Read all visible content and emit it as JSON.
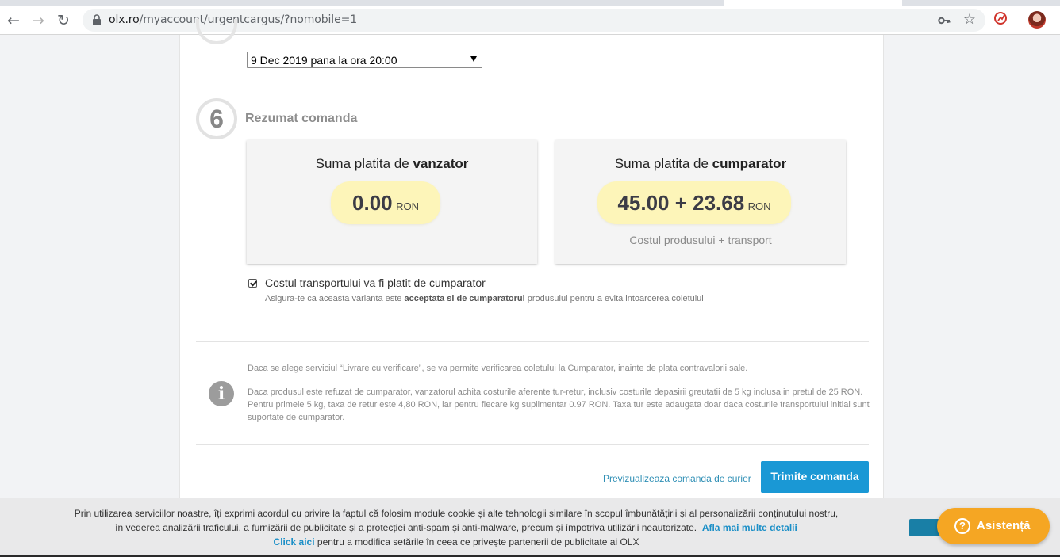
{
  "browser": {
    "url_host": "olx.ro",
    "url_path": "/myaccount/urgentcargus/?nomobile=1"
  },
  "delivery": {
    "selected_date": "9 Dec 2019 pana la ora 20:00"
  },
  "summary": {
    "step_number": "6",
    "title": "Rezumat comanda",
    "seller_title_prefix": "Suma platita de ",
    "seller_title_bold": "vanzator",
    "seller_amount": "0.00",
    "seller_currency": "RON",
    "buyer_title_prefix": "Suma platita de ",
    "buyer_title_bold": "cumparator",
    "buyer_amount": "45.00 + 23.68",
    "buyer_currency": "RON",
    "buyer_note": "Costul produsului + transport"
  },
  "transport_checkbox": {
    "checked": true,
    "label": "Costul transportului va fi platit de cumparator",
    "sub_prefix": "Asigura-te ca aceasta varianta este ",
    "sub_bold": "acceptata si de cumparatorul",
    "sub_suffix": " produsului pentru a evita intoarcerea coletului"
  },
  "info": {
    "paragraph1": "Daca se alege serviciul “Livrare cu verificare”, se va permite verificarea coletului la Cumparator, inainte de plata contravalorii sale.",
    "paragraph2": "Daca produsul este refuzat de cumparator, vanzatorul achita costurile aferente tur-retur, inclusiv costurile depasirii greutatii de 5 kg inclusa in pretul de 25 RON. Pentru primele 5 kg, taxa de retur este 4,80 RON, iar pentru fiecare kg suplimentar 0.97 RON. Taxa tur este adaugata doar daca costurile transportului initial sunt suportate de cumparator."
  },
  "actions": {
    "preview_link": "Previzualizeaza comanda de curier",
    "submit_button": "Trimite comanda"
  },
  "cookie": {
    "line1": "Prin utilizarea serviciilor noastre, îți exprimi acordul cu privire la faptul că folosim module cookie și alte tehnologii similare în scopul îmbunătățirii și al personalizării conținutului nostru,",
    "line2": "în vederea analizării traficului, a furnizării de publicitate și a protecției anti-spam și anti-malware, precum și împotriva utilizării neautorizate.",
    "more_link": "Afla mai multe detalii",
    "click_link": "Click aici",
    "line3": " pentru a modifica setările în ceea ce privește partenerii de publicitate ai OLX"
  },
  "assist": {
    "label": "Asistență"
  },
  "colors": {
    "accent": "#1a98d5",
    "price_tag": "#fdf5b9",
    "assist": "#f5a623"
  }
}
